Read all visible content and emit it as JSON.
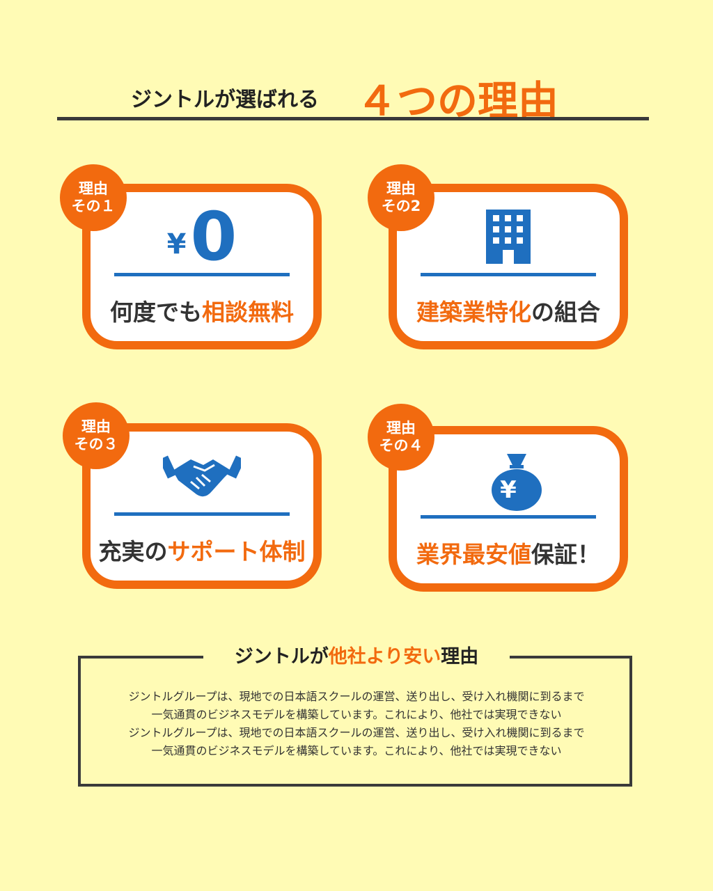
{
  "header": {
    "subtitle": "ジントルが選ばれる",
    "title": "４つの理由"
  },
  "reasons": [
    {
      "badge_line1": "理由",
      "badge_line2": "その１",
      "icon": "yen-zero",
      "yen_symbol": "¥",
      "icon_value": "0",
      "caption_plain": "何度でも",
      "caption_highlight": "相談無料",
      "caption_tail": ""
    },
    {
      "badge_line1": "理由",
      "badge_line2": "その2",
      "icon": "building-icon",
      "caption_plain": "",
      "caption_highlight": "建築業特化",
      "caption_tail": "の組合"
    },
    {
      "badge_line1": "理由",
      "badge_line2": "その３",
      "icon": "handshake-icon",
      "caption_plain": "充実の",
      "caption_highlight": "サポート体制",
      "caption_tail": ""
    },
    {
      "badge_line1": "理由",
      "badge_line2": "その４",
      "icon": "money-bag-icon",
      "money_bag_symbol": "¥",
      "caption_plain": "",
      "caption_highlight": "業界最安値",
      "caption_tail": "保証！"
    }
  ],
  "bottom": {
    "title_plain": "ジントルが",
    "title_highlight": "他社より安い",
    "title_tail": "理由",
    "lines": [
      "ジントルグループは、現地での日本語スクールの運営、送り出し、受け入れ機関に到るまで",
      "一気通貫のビジネスモデルを構築しています。これにより、他社では実現できない",
      "ジントルグループは、現地での日本語スクールの運営、送り出し、受け入れ機関に到るまで",
      "一気通貫のビジネスモデルを構築しています。これにより、他社では実現できない"
    ]
  },
  "colors": {
    "background": "#fffbb5",
    "accent_orange": "#f26a0f",
    "accent_blue": "#1f6fbf",
    "text_dark": "#222222"
  }
}
